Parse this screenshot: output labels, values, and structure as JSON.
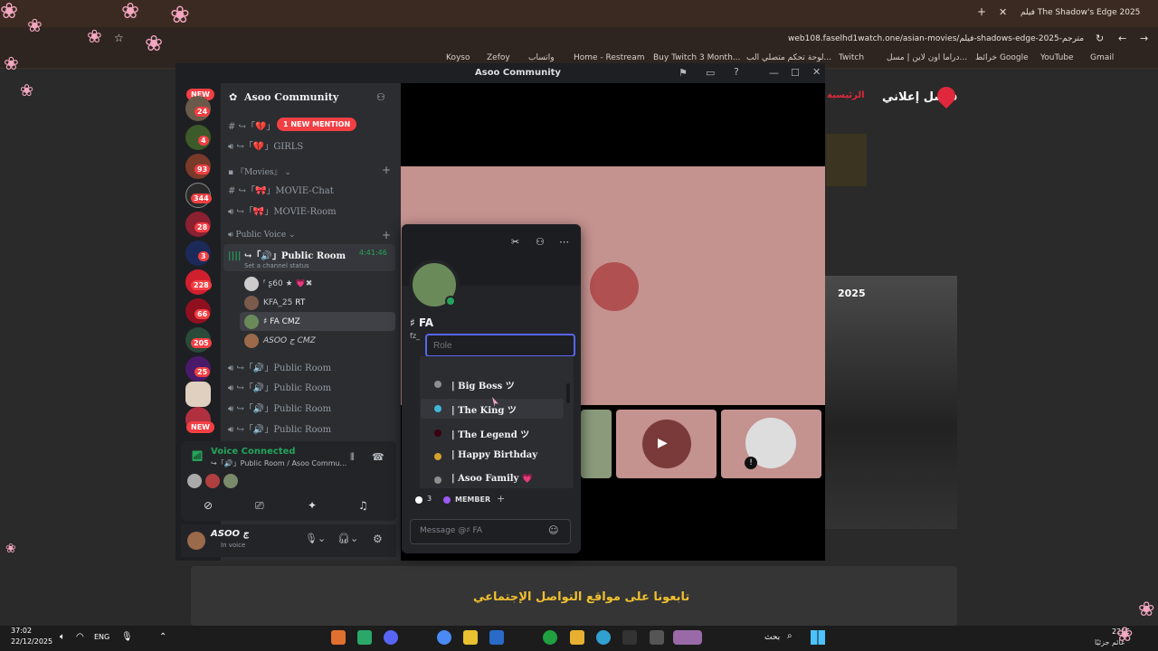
{
  "browser": {
    "tab_title": "فيلم The Shadow's Edge 2025",
    "url": "web108.faselhd1watch.one/asian-movies/فيلم-shadows-edge-2025-مترجم",
    "bookmarks": [
      "Koyso",
      "Zefoy",
      "واتساب",
      "Home - Restream",
      "Buy Twitch 3 Month...",
      "لوحة تحكم متصلي الب...",
      "Twitch",
      "دراما اون لاين | مسل...",
      "خرائط Google",
      "YouTube",
      "Gmail"
    ]
  },
  "site": {
    "logo_text": "فاصل إعلاني",
    "nav_item": "الرئيسية",
    "poster_year": "2025",
    "footer_text": "تابعونا على مواقع التواصل الإجتماعي"
  },
  "discord": {
    "window_title": "Asoo Community",
    "server_name": "Asoo Community",
    "new_badge": "NEW",
    "new_badge_bottom": "NEW",
    "server_badges": [
      "24",
      "4",
      "93",
      "344",
      "28",
      "3",
      "228",
      "66",
      "205",
      "25"
    ],
    "mention_pill": "1 NEW MENTION",
    "channels": {
      "girls": "↪︎「💔」GIRLS",
      "mention_channel": "↪︎「💔」",
      "movies_category": "『Movies』",
      "movie_chat": "↪︎「🎀」MOVIE-Chat",
      "movie_room": "↪︎「🎀」MOVIE-Room",
      "public_voice_category": "Public Voice",
      "public_room_active": "↪︎「🔊」Public Room",
      "timer": "4:41:46",
      "channel_status": "Set a channel status",
      "public_rooms": [
        "↪︎「🔊」Public Room",
        "↪︎「🔊」Public Room",
        "↪︎「🔊」Public Room",
        "↪︎「🔊」Public Room"
      ]
    },
    "members": [
      {
        "name": "ᶠ ʂ60 ★",
        "tag": "💗✖"
      },
      {
        "name": "KFA_25",
        "tag": "RT"
      },
      {
        "name": "♯ FA",
        "tag": "CMZ"
      },
      {
        "name": "ASOO ج",
        "tag": "CMZ"
      }
    ],
    "voice_panel": {
      "status": "Voice Connected",
      "location": "↪︎「🔊」Public Room / Asoo Commu..."
    },
    "user_panel": {
      "name": "ASOO ج",
      "status": "In voice"
    },
    "popout": {
      "username": "♯ FA",
      "handle": "fz_",
      "role_placeholder": "Role",
      "roles": [
        "| Big Boss ツ",
        "| The King ツ",
        "| The Legend ツ",
        "| Happy Birthday",
        "| Asoo Family 💗"
      ],
      "role_colors": [
        "#8e8e8e",
        "#3fb6d6",
        "#3b0010",
        "#d4a12a",
        "#8e8e8e"
      ],
      "role_count": "3",
      "member_role": "MEMBER",
      "message_placeholder": "Message @♯ FA"
    }
  },
  "taskbar": {
    "time": "37:02",
    "date": "22/12/2025",
    "lang": "ENG",
    "search": "بحث",
    "temp": "22°C",
    "weather": "غائم جزئيًا"
  }
}
